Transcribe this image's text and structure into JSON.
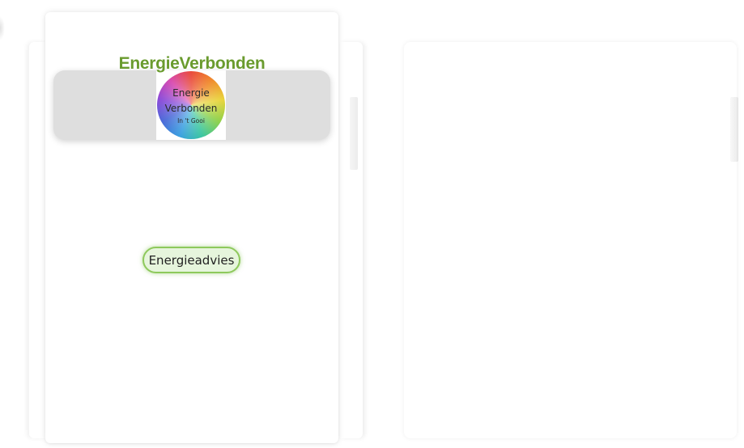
{
  "app": {
    "title": "EnergieVerbonden"
  },
  "logo": {
    "line1": "Energie",
    "line2": "Verbonden",
    "line3": "In 't Gooi"
  },
  "main": {
    "button_label": "Energieadvies"
  },
  "colors": {
    "title_green": "#6a9b2e",
    "button_border": "#8ec95c",
    "button_fill": "#e6f5dc",
    "header_band": "#dedede"
  }
}
